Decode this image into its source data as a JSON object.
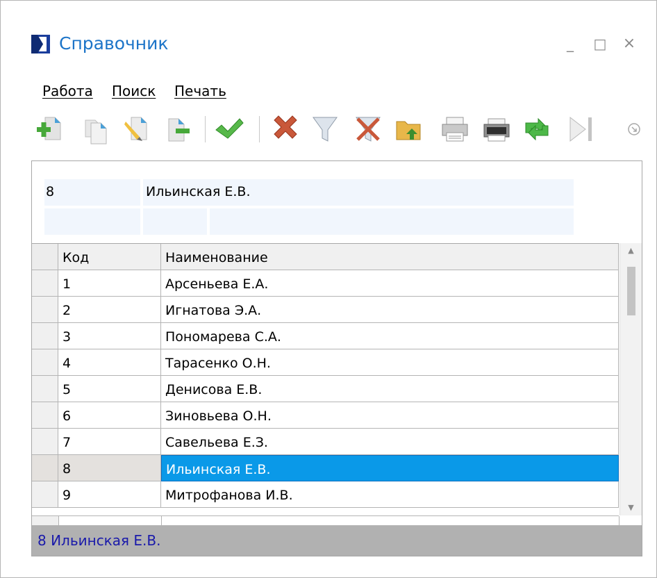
{
  "window": {
    "title": "Справочник",
    "controls": {
      "minimize": "_",
      "maximize": "□",
      "close": "×"
    }
  },
  "menu": [
    {
      "label": "Работа"
    },
    {
      "label": "Поиск"
    },
    {
      "label": "Печать"
    }
  ],
  "toolbar": [
    {
      "icon": "add-record-icon"
    },
    {
      "icon": "copy-record-icon"
    },
    {
      "icon": "edit-record-icon"
    },
    {
      "icon": "remove-record-icon"
    },
    {
      "icon": "confirm-check-icon"
    },
    {
      "icon": "delete-x-icon"
    },
    {
      "icon": "filter-icon"
    },
    {
      "icon": "clear-filter-icon"
    },
    {
      "icon": "export-folder-icon"
    },
    {
      "icon": "print-icon"
    },
    {
      "icon": "print-preview-icon"
    },
    {
      "icon": "refresh-icon"
    },
    {
      "icon": "last-record-icon"
    },
    {
      "icon": "more-options-icon"
    }
  ],
  "editor": {
    "code_value": "8",
    "name_value": "Ильинская Е.В."
  },
  "grid": {
    "columns": [
      "Код",
      "Наименование"
    ],
    "rows": [
      {
        "code": "1",
        "name": "Арсеньева Е.А."
      },
      {
        "code": "2",
        "name": "Игнатова Э.А."
      },
      {
        "code": "3",
        "name": "Пономарева С.А."
      },
      {
        "code": "4",
        "name": "Тарасенко О.Н."
      },
      {
        "code": "5",
        "name": "Денисова Е.В."
      },
      {
        "code": "6",
        "name": "Зиновьева О.Н."
      },
      {
        "code": "7",
        "name": "Савельева Е.З."
      },
      {
        "code": "8",
        "name": "Ильинская Е.В."
      },
      {
        "code": "9",
        "name": "Митрофанова И.В."
      }
    ],
    "selected_code": "8"
  },
  "status": {
    "text": "8 Ильинская Е.В."
  },
  "colors": {
    "title": "#1c74c8",
    "selection": "#0a99e8",
    "status_bg": "#b1b1b1",
    "status_text": "#1a1aaa"
  }
}
